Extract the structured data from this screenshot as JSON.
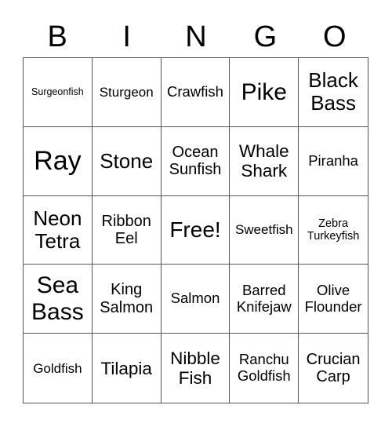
{
  "header": {
    "letters": [
      "B",
      "I",
      "N",
      "G",
      "O"
    ]
  },
  "cells": [
    "Surgeonfish",
    "Sturgeon",
    "Crawfish",
    "Pike",
    "Black Bass",
    "Ray",
    "Stone",
    "Ocean Sunfish",
    "Whale Shark",
    "Piranha",
    "Neon Tetra",
    "Ribbon Eel",
    "Free!",
    "Sweetfish",
    "Zebra Turkeyfish",
    "Sea Bass",
    "King Salmon",
    "Salmon",
    "Barred Knifejaw",
    "Olive Flounder",
    "Goldfish",
    "Tilapia",
    "Nibble Fish",
    "Ranchu Goldfish",
    "Crucian Carp"
  ]
}
